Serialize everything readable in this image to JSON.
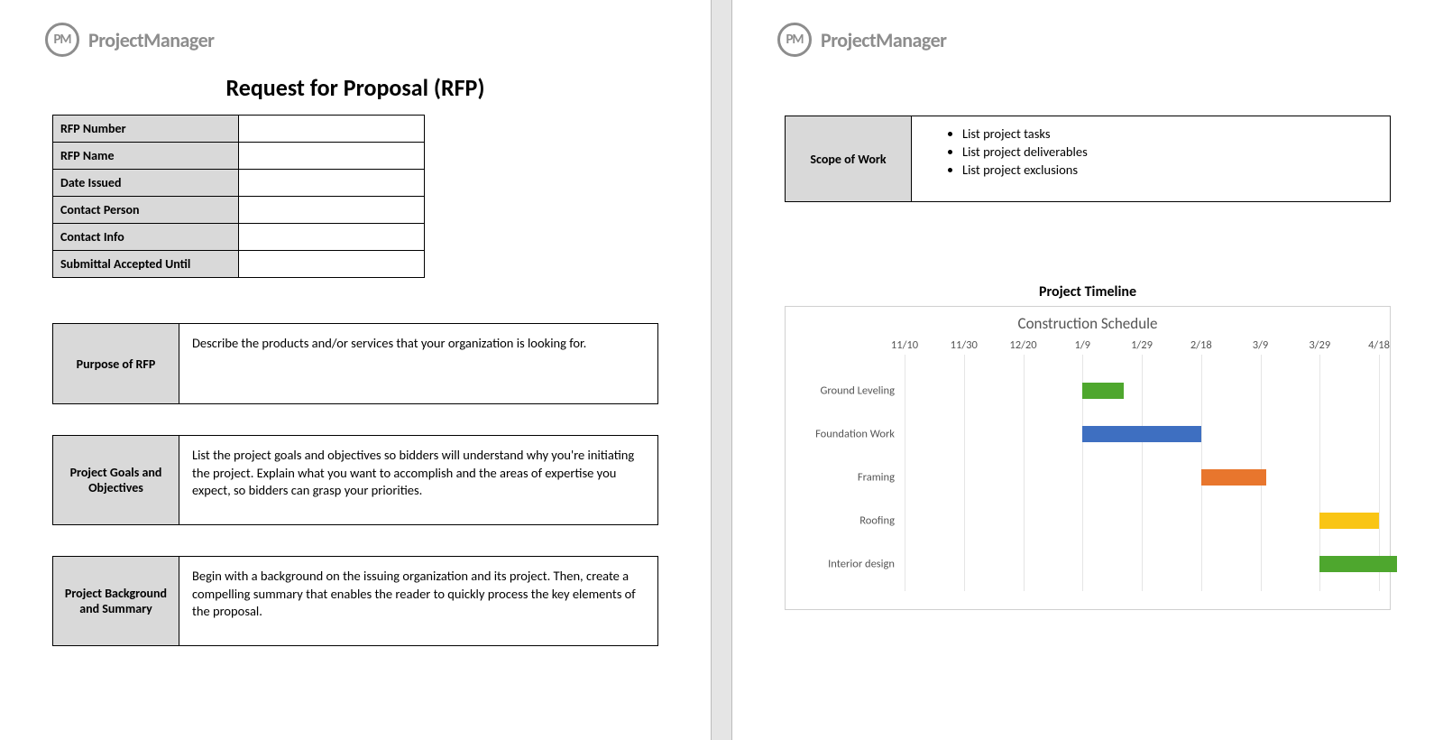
{
  "brand": {
    "logo_abbr": "PM",
    "logo_text": "ProjectManager"
  },
  "page1": {
    "title": "Request for Proposal (RFP)",
    "info_rows": [
      {
        "label": "RFP Number",
        "value": ""
      },
      {
        "label": "RFP Name",
        "value": ""
      },
      {
        "label": "Date Issued",
        "value": ""
      },
      {
        "label": "Contact Person",
        "value": ""
      },
      {
        "label": "Contact Info",
        "value": ""
      },
      {
        "label": "Submittal Accepted Until",
        "value": ""
      }
    ],
    "sections": [
      {
        "label": "Purpose of RFP",
        "body": "Describe the products and/or services that your organization is looking for."
      },
      {
        "label": "Project Goals and Objectives",
        "body": "List the project goals and objectives so bidders will understand why you're initiating the project. Explain what you want to accomplish and the areas of expertise you expect, so bidders can grasp your priorities."
      },
      {
        "label": "Project Background and Summary",
        "body": "Begin with a background on the issuing organization and its project. Then, create a compelling summary that enables the reader to quickly process the key elements of the proposal."
      }
    ]
  },
  "page2": {
    "scope": {
      "label": "Scope of Work",
      "items": [
        "List project tasks",
        "List project deliverables",
        "List project exclusions"
      ]
    },
    "chart_heading": "Project Timeline"
  },
  "chart_data": {
    "type": "gantt",
    "title": "Construction Schedule",
    "x_ticks": [
      "11/10",
      "11/30",
      "12/20",
      "1/9",
      "1/29",
      "2/18",
      "3/9",
      "3/29",
      "4/18"
    ],
    "x_range_days": [
      0,
      160
    ],
    "tasks": [
      {
        "name": "Ground Leveling",
        "start_tick_index": 3,
        "span_days": 14,
        "color": "#4ea72e"
      },
      {
        "name": "Foundation Work",
        "start_tick_index": 3,
        "span_days": 40,
        "color": "#3e6fc1"
      },
      {
        "name": "Framing",
        "start_tick_index": 5,
        "span_days": 22,
        "color": "#e8762d"
      },
      {
        "name": "Roofing",
        "start_tick_index": 7,
        "span_days": 20,
        "color": "#f9c514"
      },
      {
        "name": "Interior design",
        "start_tick_index": 7,
        "span_days": 26,
        "color": "#4ea72e"
      }
    ]
  }
}
